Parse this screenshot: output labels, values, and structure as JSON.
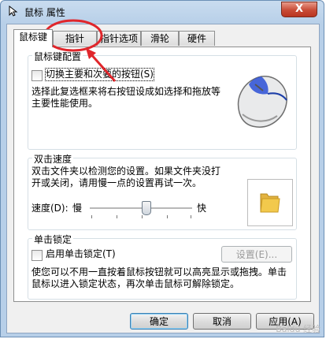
{
  "window": {
    "title": "鼠标 属性",
    "close_glyph": "X"
  },
  "tabs": [
    {
      "label": "鼠标键",
      "active": true
    },
    {
      "label": "指针",
      "active": false
    },
    {
      "label": "指针选项",
      "active": false
    },
    {
      "label": "滑轮",
      "active": false
    },
    {
      "label": "硬件",
      "active": false
    }
  ],
  "button_config": {
    "title": "鼠标键配置",
    "swap_checkbox_label": "切换主要和次要的按钮(S)",
    "swap_checked": false,
    "description": "选择此复选框来将右按钮设成如选择和拖放等主要性能使用。"
  },
  "double_click": {
    "title": "双击速度",
    "description": "双击文件夹以检测您的设置。如果文件夹没打开或关闭，请用慢一点的设置再试一次。",
    "speed_label": "速度(D):",
    "slow_label": "慢",
    "fast_label": "快",
    "speed_level": 0.55
  },
  "click_lock": {
    "title": "单击锁定",
    "checkbox_label": "启用单击锁定(T)",
    "checked": false,
    "settings_button": "设置(E)...",
    "description": "使您可以不用一直按着鼠标按钮就可以高亮显示或拖拽。单击鼠标以进入锁定状态，再次单击鼠标可解除锁定。"
  },
  "footer": {
    "ok": "确定",
    "cancel": "取消",
    "apply": "应用(A)"
  },
  "watermark": "Baidu 经验",
  "colors": {
    "annotation_red": "#e0262b",
    "folder_yellow": "#f2c94c"
  }
}
